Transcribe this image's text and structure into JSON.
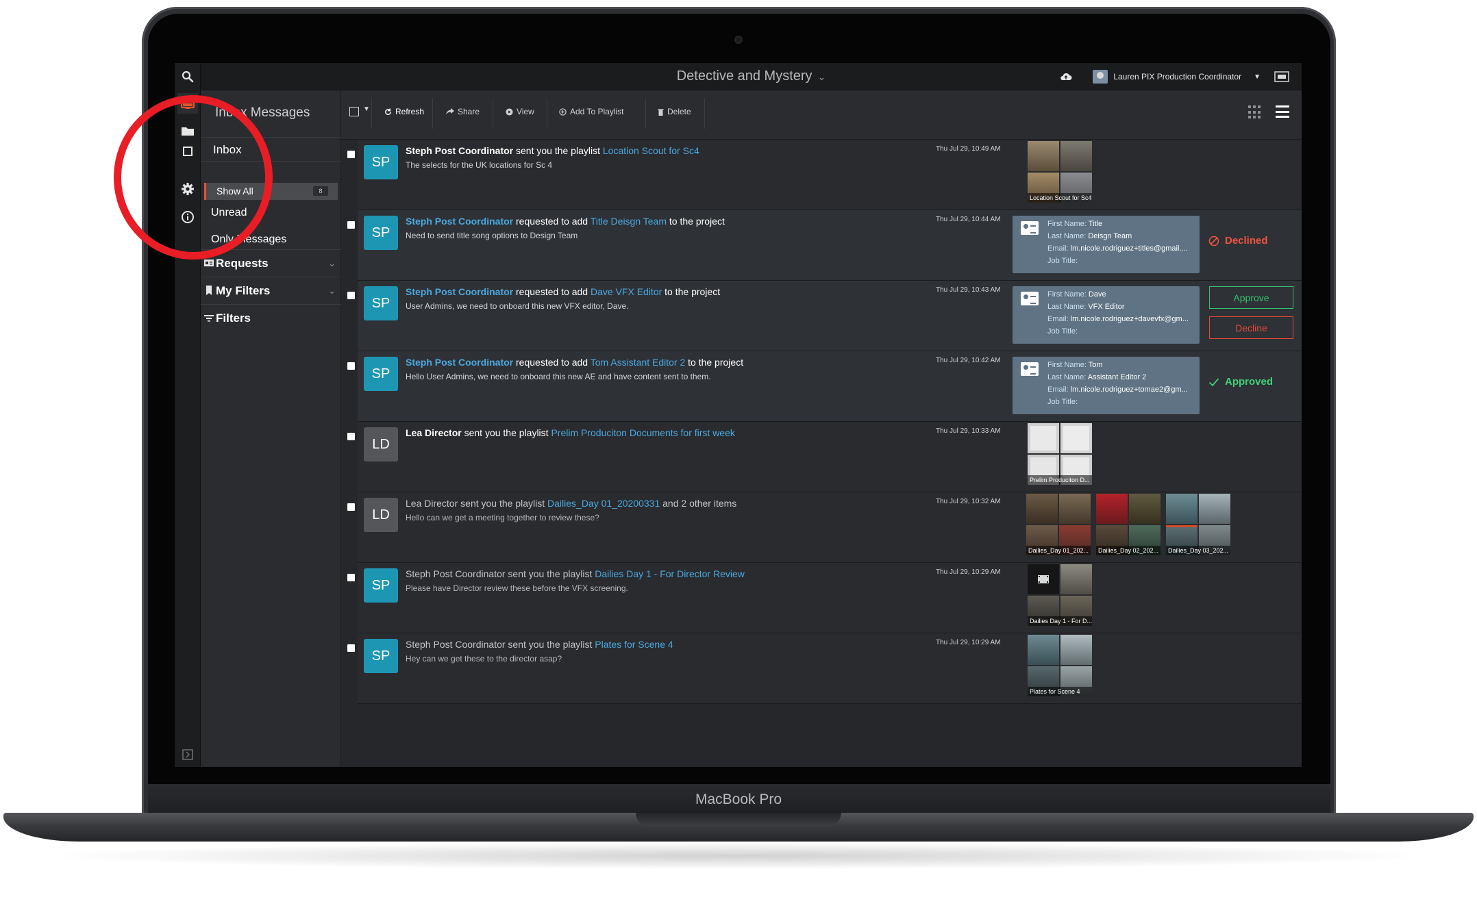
{
  "device": {
    "label": "MacBook Pro"
  },
  "topbar": {
    "project_title": "Detective and Mystery",
    "user_label": "Lauren PIX Production Coordinator",
    "user_dropdown": "▼"
  },
  "sidebar": {
    "title": "Inbox Messages",
    "inbox_label": "Inbox",
    "show_all_label": "Show All",
    "show_all_count": "8",
    "unread_label": "Unread",
    "only_messages_label": "Only Messages",
    "requests_label": "Requests",
    "my_filters_label": "My Filters",
    "filters_label": "Filters"
  },
  "toolbar": {
    "refresh": "Refresh",
    "share": "Share",
    "view": "View",
    "add_to_playlist": "Add To Playlist",
    "delete": "Delete"
  },
  "messages": [
    {
      "initials": "SP",
      "sender": "Steph Post Coordinator",
      "action": " sent you the playlist ",
      "link": "Location Scout for Sc4",
      "body": "The selects for the UK locations for Sc 4",
      "date": "Thu Jul 29, 10:49 AM",
      "thumbs": [
        "Location Scout for Sc4"
      ]
    },
    {
      "initials": "SP",
      "sender": "Steph Post Coordinator",
      "action": " requested to add ",
      "link": "Title Deisgn Team",
      "suffix": " to the project",
      "body": "Need to send title song options to Design Team",
      "date": "Thu Jul 29, 10:44 AM",
      "card": {
        "first_name": "Title",
        "last_name": "Deisgn Team",
        "email": "lm.nicole.rodriguez+titles@gmail....",
        "job_title": ""
      },
      "status": "Declined"
    },
    {
      "initials": "SP",
      "sender": "Steph Post Coordinator",
      "action": " requested to add ",
      "link": "Dave VFX Editor",
      "suffix": " to the project",
      "body": "User Admins, we need to onboard this new VFX editor, Dave.",
      "date": "Thu Jul 29, 10:43 AM",
      "card": {
        "first_name": "Dave",
        "last_name": "VFX Editor",
        "email": "lm.nicole.rodriguez+davevfx@gm...",
        "job_title": ""
      },
      "approve_label": "Approve",
      "decline_label": "Decline"
    },
    {
      "initials": "SP",
      "sender": "Steph Post Coordinator",
      "action": " requested to add ",
      "link": "Tom Assistant Editor 2",
      "suffix": " to the project",
      "body": "Hello User Admins, we need to onboard this new AE and have content sent to them.",
      "date": "Thu Jul 29, 10:42 AM",
      "card": {
        "first_name": "Tom",
        "last_name": "Assistant Editor 2",
        "email": "lm.nicole.rodriguez+tomae2@gm...",
        "job_title": ""
      },
      "status": "Approved"
    },
    {
      "initials": "LD",
      "sender": "Lea Director",
      "action": " sent you the playlist ",
      "link": "Prelim Produciton Documents for first week",
      "body": "",
      "date": "Thu Jul 29, 10:33 AM",
      "thumbs": [
        "Prelim Produciton D..."
      ]
    },
    {
      "initials": "LD",
      "sender": "Lea Director",
      "action": " sent you the playlist ",
      "link": "Dailies_Day 01_20200331",
      "suffix": " and 2 other items",
      "body": "Hello can we get a meeting together to review these?",
      "date": "Thu Jul 29, 10:32 AM",
      "thumbs": [
        "Dailies_Day 01_202...",
        "Dailies_Day 02_202...",
        "Dailies_Day 03_202..."
      ]
    },
    {
      "initials": "SP",
      "sender": "Steph Post Coordinator",
      "action": " sent you the playlist ",
      "link": "Dailies Day 1 - For Director Review",
      "body": "Please have Director review these before the VFX screening.",
      "date": "Thu Jul 29, 10:29 AM",
      "thumbs": [
        "Dailies Day 1 - For D..."
      ]
    },
    {
      "initials": "SP",
      "sender": "Steph Post Coordinator",
      "action": " sent you the playlist ",
      "link": "Plates for Scene 4",
      "body": "Hey can we get these to the director asap?",
      "date": "Thu Jul 29, 10:29 AM",
      "thumbs": [
        "Plates for Scene 4"
      ]
    }
  ],
  "card_labels": {
    "first": "First Name:",
    "last": "Last Name:",
    "email": "Email:",
    "job": "Job Title:"
  },
  "colors": {
    "accent_orange": "#e4542c",
    "link_blue": "#4aa9e0",
    "approve_green": "#34c36f",
    "decline_red": "#e44a35",
    "annotation_red": "#e81d25"
  }
}
